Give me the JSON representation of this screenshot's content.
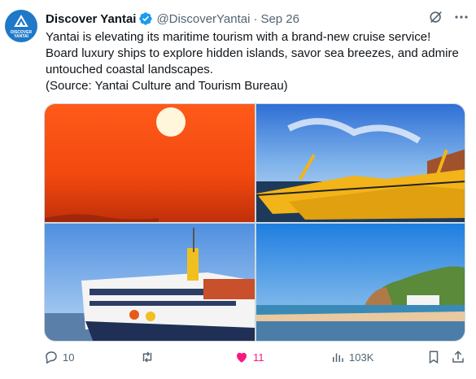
{
  "author": {
    "name": "Discover Yantai",
    "handle": "@DiscoverYantai",
    "date": "Sep 26",
    "avatar_text": "DISCOVER YANTAI"
  },
  "tweet": {
    "lines": [
      "Yantai is elevating its maritime tourism with a brand-new cruise service!",
      "Board luxury ships to explore hidden islands, savor sea breezes, and admire",
      "untouched coastal landscapes.",
      "(Source: Yantai Culture and Tourism Bureau)"
    ]
  },
  "media": [
    {
      "description_icon": "sunset-photo"
    },
    {
      "description_icon": "cruise-ships-photo"
    },
    {
      "description_icon": "white-cruise-ship-photo"
    },
    {
      "description_icon": "coastal-island-photo"
    }
  ],
  "actions": {
    "replies": "10",
    "retweets": "",
    "likes": "11",
    "views": "103K"
  },
  "colors": {
    "accent_blue": "#1d9bf0",
    "like_pink": "#f91880",
    "muted": "#536471",
    "text": "#0f1419"
  }
}
